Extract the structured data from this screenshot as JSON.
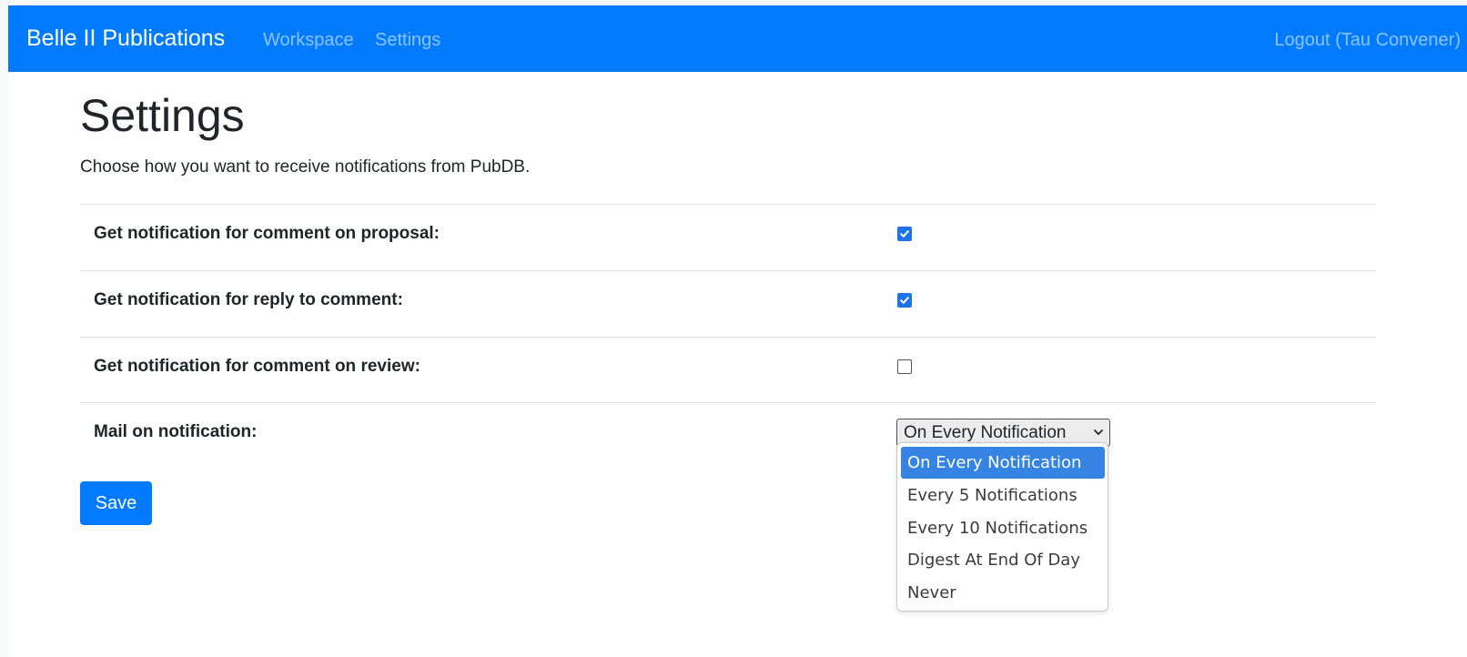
{
  "navbar": {
    "brand": "Belle II Publications",
    "links": [
      "Workspace",
      "Settings"
    ],
    "logout": "Logout (Tau Convener)",
    "color": "#007bff"
  },
  "page": {
    "title": "Settings",
    "subtitle": "Choose how you want to receive notifications from PubDB."
  },
  "settings": [
    {
      "label": "Get notification for comment on proposal:",
      "checked": true
    },
    {
      "label": "Get notification for reply to comment:",
      "checked": true
    },
    {
      "label": "Get notification for comment on review:",
      "checked": false
    }
  ],
  "mail": {
    "label": "Mail on notification:",
    "selected": "On Every Notification",
    "options": [
      "On Every Notification",
      "Every 5 Notifications",
      "Every 10 Notifications",
      "Digest At End Of Day",
      "Never"
    ],
    "highlighted_option": "On Every Notification"
  },
  "save_label": "Save",
  "icons": {
    "checkbox_checked": "checkmark-icon",
    "select_caret": "chevron-down-icon"
  }
}
